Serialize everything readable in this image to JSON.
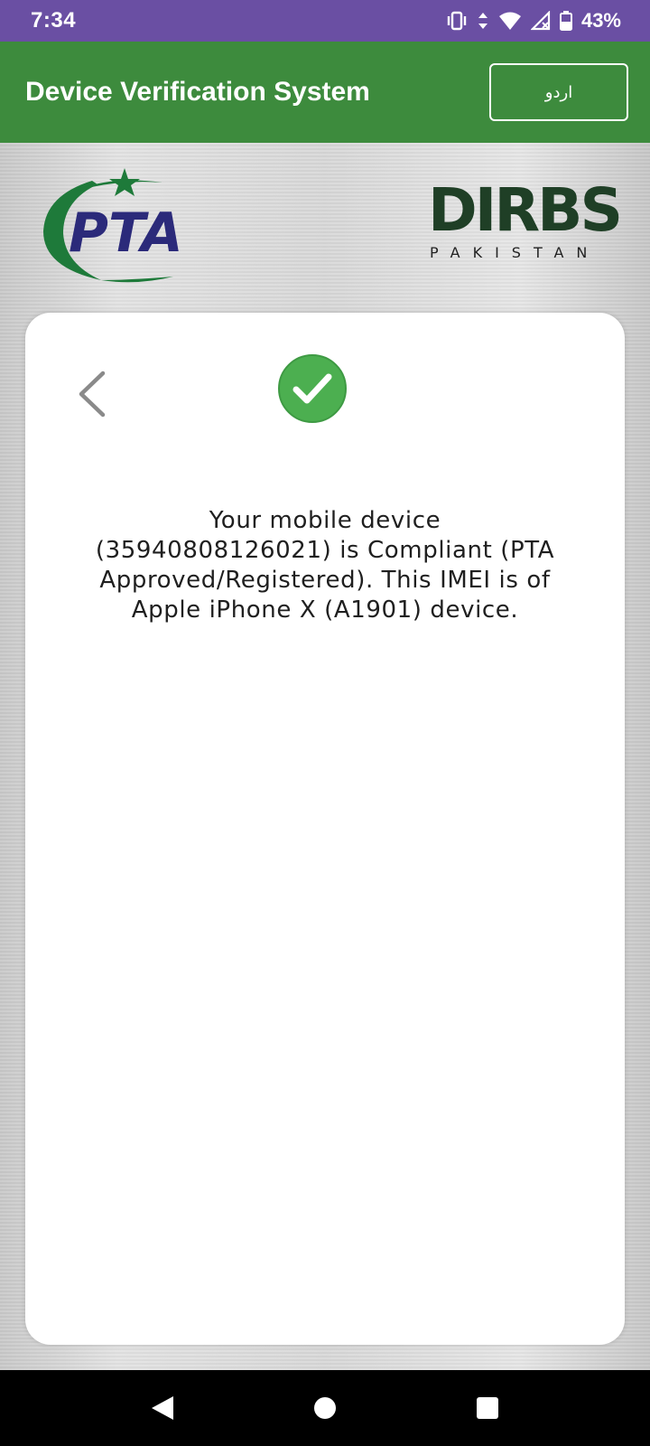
{
  "status_bar": {
    "time": "7:34",
    "battery": "43%",
    "icons": [
      "vibrate-icon",
      "data-arrows-icon",
      "wifi-icon",
      "no-signal-icon",
      "battery-icon"
    ]
  },
  "app_bar": {
    "title": "Device Verification System",
    "language_button": "اردو"
  },
  "logos": {
    "left_logo": "PTA",
    "right_logo": "DIRBS",
    "right_logo_sub": "PAKISTAN"
  },
  "card": {
    "status_icon": "check-circle-icon",
    "message": "Your mobile device (35940808126021) is Compliant (PTA Approved/Registered). This IMEI is of Apple iPhone X (A1901) device."
  },
  "colors": {
    "status_bar": "#6a4fa3",
    "app_bar": "#3d8b3d",
    "success": "#4caf50",
    "pta_blue": "#2b2a7a",
    "pta_green": "#1e7a3a"
  },
  "nav_bar": {
    "icons": [
      "back-triangle-icon",
      "home-circle-icon",
      "recents-square-icon"
    ]
  }
}
